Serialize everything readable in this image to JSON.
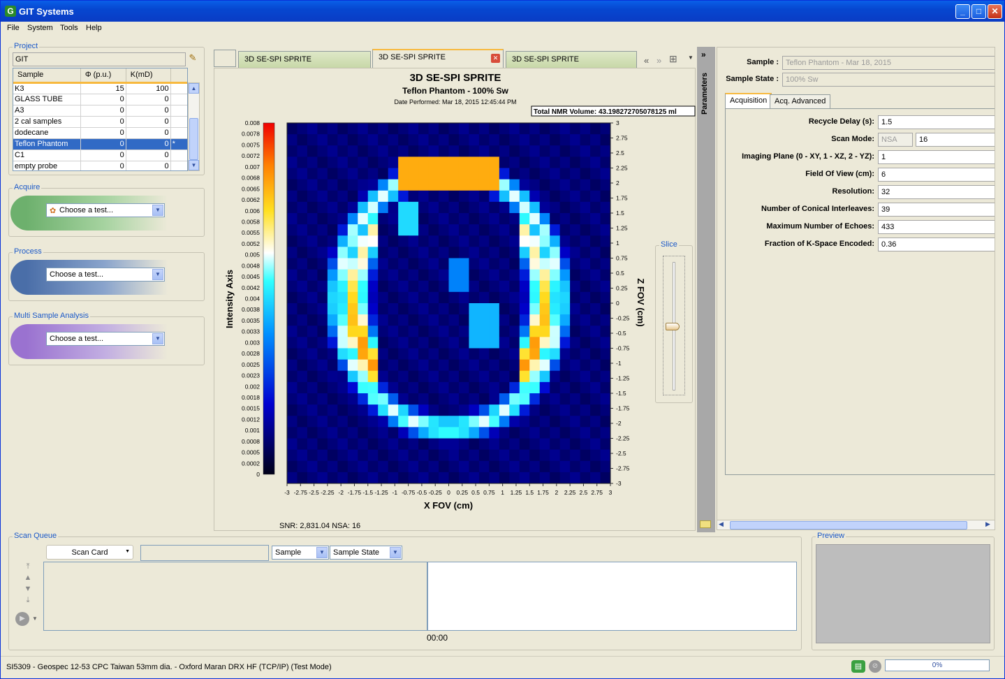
{
  "window": {
    "title": "GIT Systems",
    "app_icon": "G"
  },
  "menu": [
    "File",
    "System",
    "Tools",
    "Help"
  ],
  "project": {
    "label": "Project",
    "name": "GIT",
    "columns": [
      "Sample",
      "Φ (p.u.)",
      "K(mD)"
    ],
    "rows": [
      {
        "sample": "K3",
        "phi": "15",
        "k": "100",
        "flag": ""
      },
      {
        "sample": "GLASS TUBE",
        "phi": "0",
        "k": "0",
        "flag": ""
      },
      {
        "sample": "A3",
        "phi": "0",
        "k": "0",
        "flag": ""
      },
      {
        "sample": "2 cal samples",
        "phi": "0",
        "k": "0",
        "flag": ""
      },
      {
        "sample": "dodecane",
        "phi": "0",
        "k": "0",
        "flag": ""
      },
      {
        "sample": "Teflon Phantom",
        "phi": "0",
        "k": "0",
        "flag": "*"
      },
      {
        "sample": "C1",
        "phi": "0",
        "k": "0",
        "flag": ""
      },
      {
        "sample": "empty probe",
        "phi": "0",
        "k": "0",
        "flag": ""
      }
    ],
    "selected_row": 5
  },
  "acquire": {
    "label": "Acquire",
    "combo": "Choose a test...",
    "color": "#6db06d"
  },
  "process": {
    "label": "Process",
    "combo": "Choose a test...",
    "color": "#4a6ea8"
  },
  "multi": {
    "label": "Multi Sample Analysis",
    "combo": "Choose a test...",
    "color": "#9a72d0"
  },
  "tabs": [
    {
      "label": "3D SE-SPI SPRITE",
      "active": false
    },
    {
      "label": "3D SE-SPI SPRITE",
      "active": true
    },
    {
      "label": "3D SE-SPI SPRITE",
      "active": false
    }
  ],
  "plot": {
    "title": "3D SE-SPI SPRITE",
    "subtitle": "Teflon Phantom - 100% Sw",
    "date": "Date Performed: Mar 18, 2015 12:45:44 PM",
    "volume": "Total NMR Volume: 43.198272705078125 ml",
    "snr": "SNR: 2,831.04 NSA: 16",
    "colorbar_label": "Intensity Axis",
    "colorbar_ticks": [
      "0.008",
      "0.0078",
      "0.0075",
      "0.0072",
      "0.007",
      "0.0068",
      "0.0065",
      "0.0062",
      "0.006",
      "0.0058",
      "0.0055",
      "0.0052",
      "0.005",
      "0.0048",
      "0.0045",
      "0.0042",
      "0.004",
      "0.0038",
      "0.0035",
      "0.0033",
      "0.003",
      "0.0028",
      "0.0025",
      "0.0023",
      "0.002",
      "0.0018",
      "0.0015",
      "0.0012",
      "0.001",
      "0.0008",
      "0.0005",
      "0.0002",
      "0"
    ],
    "xlabel": "X FOV (cm)",
    "ylabel": "Z FOV (cm)",
    "xticks": [
      "-3",
      "-2.75",
      "-2.5",
      "-2.25",
      "-2",
      "-1.75",
      "-1.5",
      "-1.25",
      "-1",
      "-0.75",
      "-0.5",
      "-0.25",
      "0",
      "0.25",
      "0.5",
      "0.75",
      "1",
      "1.25",
      "1.5",
      "1.75",
      "2",
      "2.25",
      "2.5",
      "2.75",
      "3"
    ],
    "yticks": [
      "3",
      "2.75",
      "2.5",
      "2.25",
      "2",
      "1.75",
      "1.5",
      "1.25",
      "1",
      "0.75",
      "0.5",
      "0.25",
      "0",
      "-0.25",
      "-0.5",
      "-0.75",
      "-1",
      "-1.25",
      "-1.5",
      "-1.75",
      "-2",
      "-2.25",
      "-2.5",
      "-2.75",
      "-3"
    ]
  },
  "slice": {
    "label": "Slice",
    "value": 0.5
  },
  "parameters": {
    "sidebar_label": "Parameters",
    "collapse": "»",
    "sample_label": "Sample :",
    "sample_value": "Teflon Phantom - Mar 18, 2015",
    "state_label": "Sample State :",
    "state_value": "100% Sw",
    "tabs": [
      "Acquisition",
      "Acq. Advanced"
    ],
    "rows": [
      {
        "label": "Recycle Delay (s):",
        "value": "1.5"
      },
      {
        "label": "Scan Mode:",
        "value": "16",
        "select": "NSA"
      },
      {
        "label": "Imaging Plane (0 - XY, 1 - XZ, 2 - YZ):",
        "value": "1"
      },
      {
        "label": "Field Of View (cm):",
        "value": "6"
      },
      {
        "label": "Resolution:",
        "value": "32"
      },
      {
        "label": "Number of Conical Interleaves:",
        "value": "39"
      },
      {
        "label": "Maximum Number of Echoes:",
        "value": "433"
      },
      {
        "label": "Fraction of K-Space Encoded:",
        "value": "0.36"
      }
    ]
  },
  "scanqueue": {
    "label": "Scan Queue",
    "scan_card": "Scan Card",
    "sample_combo": "Sample",
    "state_combo": "Sample State",
    "time": "00:00"
  },
  "preview": {
    "label": "Preview"
  },
  "status": {
    "text": "SI5309 - Geospec 12-53 CPC Taiwan 53mm dia. - Oxford Maran DRX HF (TCP/IP) (Test Mode)",
    "progress": "0%"
  }
}
